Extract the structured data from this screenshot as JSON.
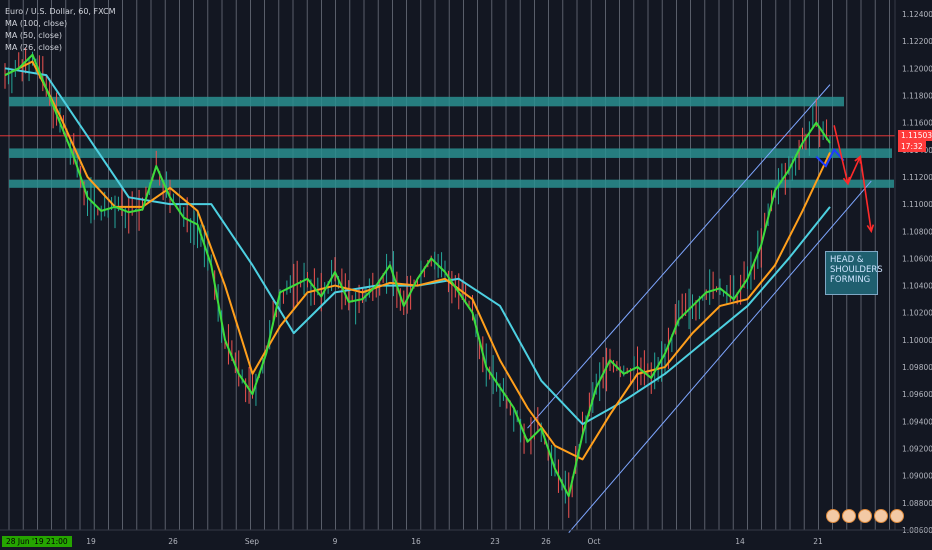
{
  "legend": {
    "symbol": "Euro / U.S. Dollar, 60, FXCM",
    "ma100": "MA (100, close)",
    "ma50": "MA (50, close)",
    "ma26": "MA (26, close)"
  },
  "annotation": "HEAD & SHOULDERS FORMING",
  "price_tag": {
    "price": "1.11503",
    "countdown": "17:32"
  },
  "time_tag": "28 Jun '19   21:00",
  "colors": {
    "background": "#131722",
    "zone": "#2a8f8f",
    "ma100": "#4dd0e1",
    "ma50": "#ff9f1c",
    "ma26": "#3ddc3d",
    "channel": "#7ea6ff",
    "arrow": "#ff2a2a",
    "shoulder": "#1e3cff",
    "current_price": "#ff3b3b"
  },
  "chart_data": {
    "type": "line",
    "title": "Euro / U.S. Dollar, 60, FXCM",
    "x_ticks": [
      "19",
      "26",
      "Sep",
      "9",
      "16",
      "23",
      "26",
      "Oct",
      "14",
      "21"
    ],
    "y_ticks": [
      "1.12400",
      "1.12200",
      "1.12000",
      "1.11800",
      "1.11600",
      "1.11400",
      "1.11200",
      "1.11000",
      "1.10800",
      "1.10600",
      "1.10400",
      "1.10200",
      "1.10000",
      "1.09800",
      "1.09600",
      "1.09400",
      "1.09200",
      "1.09000",
      "1.08800",
      "1.08600"
    ],
    "ylim": [
      1.086,
      1.125
    ],
    "current_price": 1.11503,
    "resistance_zones": [
      {
        "name": "upper",
        "low": 1.1172,
        "high": 1.1179
      },
      {
        "name": "middle",
        "low": 1.1134,
        "high": 1.1141
      },
      {
        "name": "lower",
        "low": 1.1112,
        "high": 1.1118
      }
    ],
    "series": [
      {
        "name": "MA (26, close)",
        "x": [
          0,
          1,
          2,
          3,
          4,
          5,
          6,
          7,
          8,
          9,
          10,
          11,
          12,
          13,
          14,
          15,
          16,
          17,
          18,
          19,
          20,
          21,
          22,
          23,
          24,
          25,
          26,
          27,
          28,
          29,
          30,
          31,
          32,
          33,
          34,
          35,
          36,
          37,
          38,
          39,
          40,
          41,
          42,
          43,
          44,
          45,
          46,
          47,
          48,
          49,
          50,
          51,
          52,
          53,
          54,
          55,
          56,
          57,
          58,
          59,
          60
        ],
        "values": [
          1.1195,
          1.12,
          1.121,
          1.1185,
          1.116,
          1.1135,
          1.1105,
          1.1095,
          1.1098,
          1.1094,
          1.1096,
          1.1128,
          1.1105,
          1.109,
          1.1085,
          1.1055,
          1.1,
          1.0975,
          1.096,
          1.099,
          1.1035,
          1.104,
          1.1045,
          1.1032,
          1.105,
          1.1028,
          1.103,
          1.104,
          1.1055,
          1.1025,
          1.1045,
          1.106,
          1.105,
          1.1035,
          1.102,
          1.098,
          1.0965,
          1.095,
          1.0925,
          1.0935,
          1.0905,
          1.0885,
          1.093,
          1.0965,
          1.0985,
          1.0975,
          1.098,
          1.0972,
          1.099,
          1.1015,
          1.1025,
          1.1035,
          1.1038,
          1.103,
          1.1045,
          1.107,
          1.111,
          1.1125,
          1.1145,
          1.116,
          1.1145
        ]
      },
      {
        "name": "MA (50, close)",
        "x": [
          0,
          2,
          4,
          6,
          8,
          10,
          12,
          14,
          16,
          18,
          20,
          22,
          24,
          26,
          28,
          30,
          32,
          34,
          36,
          38,
          40,
          42,
          44,
          46,
          48,
          50,
          52,
          54,
          56,
          58,
          60
        ],
        "values": [
          1.1195,
          1.1205,
          1.1165,
          1.112,
          1.1098,
          1.1098,
          1.1112,
          1.1095,
          1.104,
          1.0975,
          1.101,
          1.1035,
          1.104,
          1.1035,
          1.1042,
          1.104,
          1.1045,
          1.103,
          1.0985,
          1.095,
          1.0922,
          1.0912,
          1.0945,
          1.0975,
          1.098,
          1.1005,
          1.1025,
          1.103,
          1.1055,
          1.1095,
          1.1138
        ]
      },
      {
        "name": "MA (100, close)",
        "x": [
          0,
          3,
          6,
          9,
          12,
          15,
          18,
          21,
          24,
          27,
          30,
          33,
          36,
          39,
          42,
          45,
          48,
          51,
          54,
          57,
          60
        ],
        "values": [
          1.12,
          1.1195,
          1.115,
          1.1105,
          1.11,
          1.11,
          1.1055,
          1.1005,
          1.1035,
          1.104,
          1.104,
          1.1045,
          1.1025,
          1.097,
          1.0938,
          1.0955,
          1.0975,
          1.1,
          1.1025,
          1.106,
          1.1098
        ]
      }
    ],
    "channel": {
      "upper": [
        [
          38,
          1.0935
        ],
        [
          60,
          1.1188
        ]
      ],
      "lower": [
        [
          41,
          1.0858
        ],
        [
          63,
          1.1117
        ]
      ]
    },
    "projection": {
      "shoulder": [
        [
          59,
          1.1135
        ],
        [
          59.7,
          1.1128
        ],
        [
          60.3,
          1.114
        ],
        [
          61,
          1.1132
        ]
      ],
      "arrows": [
        [
          [
            60.3,
            1.1158
          ],
          [
            61.3,
            1.1115
          ]
        ],
        [
          [
            61.3,
            1.1115
          ],
          [
            62.2,
            1.1135
          ]
        ],
        [
          [
            62.2,
            1.1135
          ],
          [
            63,
            1.108
          ]
        ]
      ]
    }
  }
}
